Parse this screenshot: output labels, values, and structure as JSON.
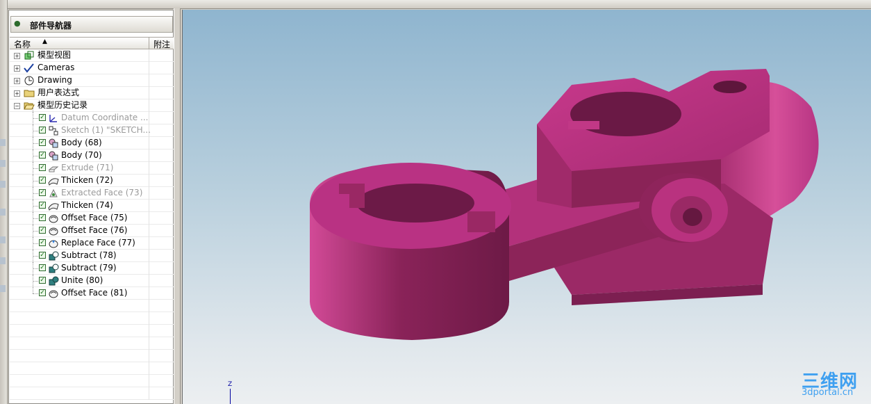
{
  "navigator": {
    "title": "部件导航器",
    "columns": {
      "name": "名称",
      "attach": "附注"
    },
    "rows": [
      {
        "label": "模型视图",
        "level": 0,
        "expander": "+",
        "icon": "model-views-icon",
        "dim": false
      },
      {
        "label": "Cameras",
        "level": 0,
        "expander": "+",
        "icon": "cameras-icon",
        "dim": false
      },
      {
        "label": "Drawing",
        "level": 0,
        "expander": "+",
        "icon": "drawing-icon",
        "dim": false
      },
      {
        "label": "用户表达式",
        "level": 0,
        "expander": "+",
        "icon": "folder-icon",
        "dim": false
      },
      {
        "label": "模型历史记录",
        "level": 0,
        "expander": "-",
        "icon": "folder-open-icon",
        "dim": false
      },
      {
        "label": "Datum Coordinate ...",
        "level": 1,
        "icon": "datum-csys-icon",
        "dim": true
      },
      {
        "label": "Sketch (1) \"SKETCH...",
        "level": 1,
        "icon": "sketch-icon",
        "dim": true
      },
      {
        "label": "Body (68)",
        "level": 1,
        "icon": "body-icon",
        "dim": false
      },
      {
        "label": "Body (70)",
        "level": 1,
        "icon": "body-icon",
        "dim": false
      },
      {
        "label": "Extrude (71)",
        "level": 1,
        "icon": "extrude-icon",
        "dim": true
      },
      {
        "label": "Thicken (72)",
        "level": 1,
        "icon": "thicken-icon",
        "dim": false
      },
      {
        "label": "Extracted Face (73)",
        "level": 1,
        "icon": "extracted-face-icon",
        "dim": true
      },
      {
        "label": "Thicken (74)",
        "level": 1,
        "icon": "thicken-icon",
        "dim": false
      },
      {
        "label": "Offset Face (75)",
        "level": 1,
        "icon": "offset-face-icon",
        "dim": false
      },
      {
        "label": "Offset Face (76)",
        "level": 1,
        "icon": "offset-face-icon",
        "dim": false
      },
      {
        "label": "Replace Face (77)",
        "level": 1,
        "icon": "replace-face-icon",
        "dim": false
      },
      {
        "label": "Subtract (78)",
        "level": 1,
        "icon": "subtract-icon",
        "dim": false
      },
      {
        "label": "Subtract (79)",
        "level": 1,
        "icon": "subtract-icon",
        "dim": false
      },
      {
        "label": "Unite (80)",
        "level": 1,
        "icon": "unite-icon",
        "dim": false
      },
      {
        "label": "Offset Face (81)",
        "level": 1,
        "icon": "offset-face-icon",
        "dim": false
      }
    ]
  },
  "viewport": {
    "axis_label": "Z",
    "part_color": "#b8307e",
    "watermark": {
      "main": "三维网",
      "sub": "3dportal.cn",
      "color": "#3fa0f0"
    }
  }
}
